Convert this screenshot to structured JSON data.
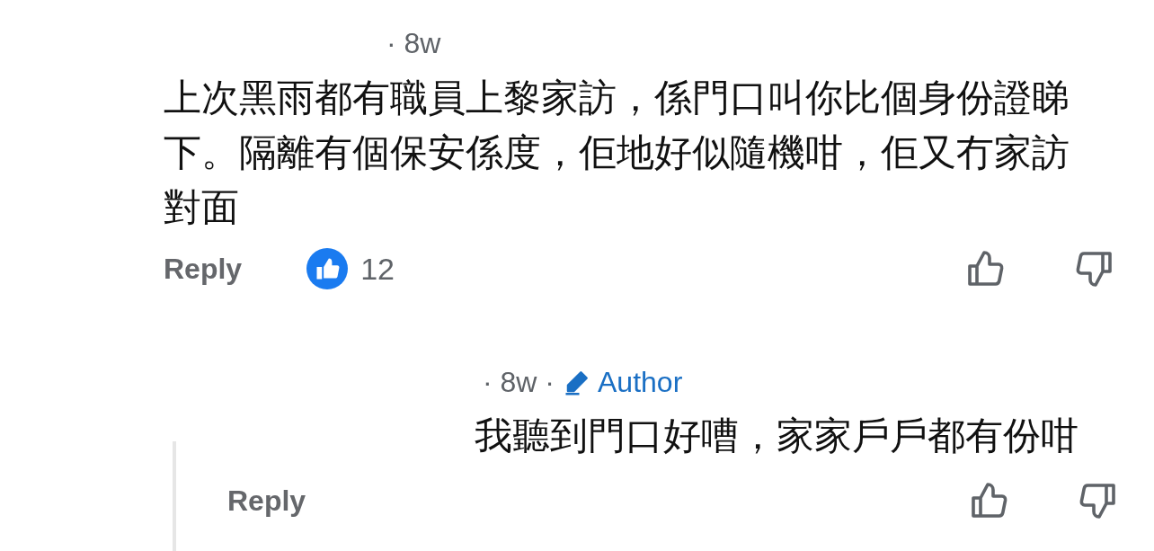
{
  "comment": {
    "time": "· 8w",
    "text": "上次黑雨都有職員上黎家訪，係門口叫你比個身份證睇下。隔離有個保安係度，佢地好似隨機咁，佢又冇家訪對面",
    "reply_label": "Reply",
    "reaction_count": "12"
  },
  "reply": {
    "time": "· 8w ·",
    "author_badge": "Author",
    "text": "我聽到門口好嘈，家家戶戶都有份咁",
    "reply_label": "Reply"
  }
}
